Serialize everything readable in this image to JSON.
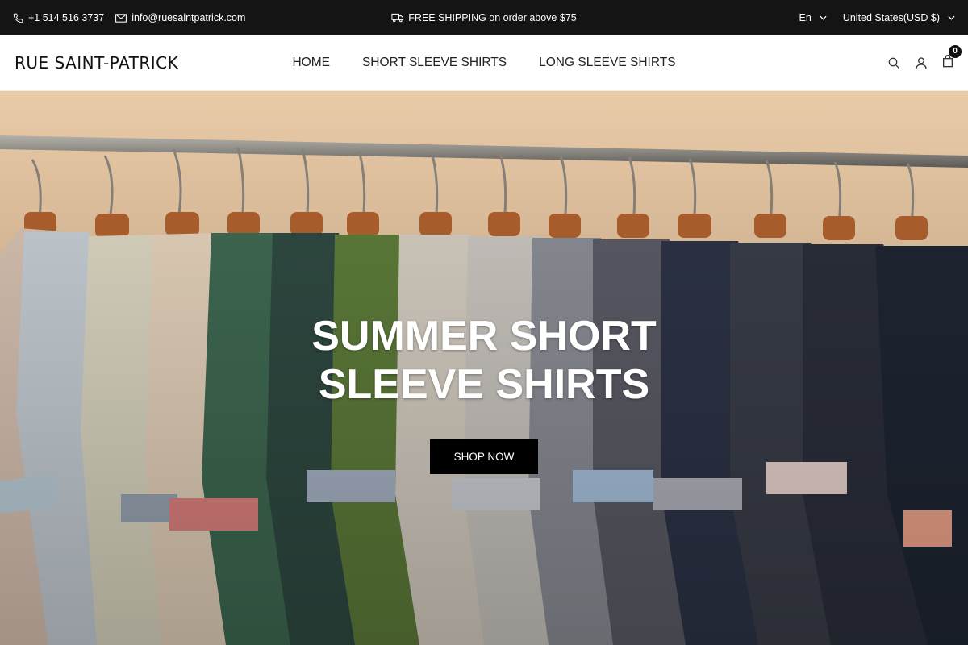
{
  "topbar": {
    "phone": "+1 514 516 3737",
    "email": "info@ruesaintpatrick.com",
    "shipping": "FREE SHIPPING on order above $75",
    "language": "En",
    "currency": "United States(USD $)"
  },
  "header": {
    "logo": "RUE SAINT-PATRICK",
    "nav": [
      "HOME",
      "SHORT SLEEVE SHIRTS",
      "LONG SLEEVE SHIRTS"
    ],
    "cart_count": "0"
  },
  "hero": {
    "title_line1": "SUMMER SHORT",
    "title_line2": "SLEEVE SHIRTS",
    "cta": "SHOP NOW"
  },
  "colors": {
    "topbar_bg": "#141414",
    "hero_wall": "#e7c7a4",
    "button_bg": "#000000"
  },
  "icons": [
    "phone-icon",
    "mail-icon",
    "truck-icon",
    "chevron-down-icon",
    "search-icon",
    "user-icon",
    "bag-icon"
  ]
}
